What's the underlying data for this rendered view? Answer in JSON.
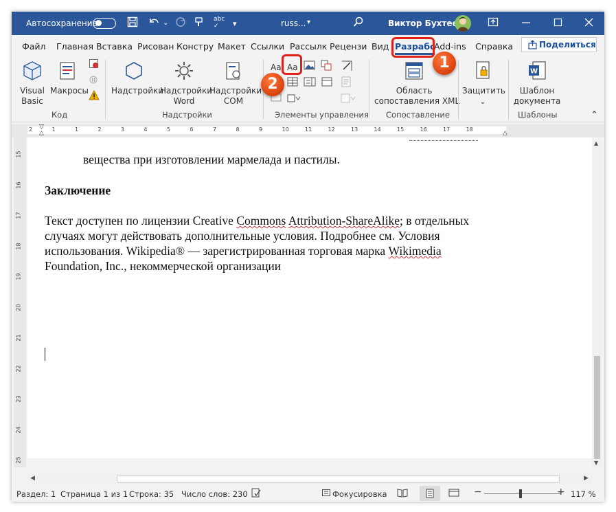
{
  "titlebar": {
    "autosave_label": "Автосохранение",
    "filename": "russ...",
    "user_name": "Виктор Бухтеев"
  },
  "tabs": [
    "Файл",
    "Главная",
    "Вставка",
    "Рисован",
    "Констру",
    "Макет",
    "Ссылки",
    "Рассылк",
    "Рецензи",
    "Вид",
    "Разрабс",
    "Add-ins",
    "Справка"
  ],
  "share_label": "Поделиться",
  "ribbon": {
    "code": {
      "visual_basic": [
        "Visual",
        "Basic"
      ],
      "macros": "Макросы",
      "label": "Код"
    },
    "addins": {
      "addins": "Надстройки",
      "word_addins": [
        "Надстройки",
        "Word"
      ],
      "com_addins": [
        "Надстройки",
        "COM"
      ],
      "label": "Надстройки"
    },
    "controls": {
      "rich_text_glyph": "Aa",
      "plain_text_glyph": "Aa",
      "label": "Элементы управления"
    },
    "mapping": {
      "xml_pane": [
        "Область",
        "сопоставления XML"
      ],
      "label": "Сопоставление"
    },
    "protect": {
      "protect": "Защитить"
    },
    "templates": {
      "doc_template": [
        "Шаблон",
        "документа"
      ],
      "label": "Шаблоны"
    }
  },
  "callouts": [
    "1",
    "2"
  ],
  "document": {
    "top_line": "вещества при изготовлении мармелада и пастилы.",
    "heading": "Заключение",
    "p1": "Текст доступен по лицензии Creative ",
    "p1_err1": "Commons",
    "p1_sp": " ",
    "p1_err2": "Attribution-ShareAlike",
    "p1_end": "; в отдельных",
    "p2": "случаях могут действовать дополнительные условия. Подробнее см. Условия",
    "p3": "использования. Wikipedia® — зарегистрированная торговая марка ",
    "p3_err": "Wikimedia",
    "p4": "Foundation, Inc., некоммерческой организации"
  },
  "ruler_h": [
    "2",
    "1",
    "1",
    "2",
    "3",
    "4",
    "5",
    "6",
    "7",
    "8",
    "9",
    "10",
    "11",
    "12",
    "13",
    "14",
    "15",
    "16",
    "17",
    "18"
  ],
  "ruler_v": [
    "15",
    "16",
    "17",
    "18",
    "19",
    "20",
    "21",
    "22",
    "23",
    "24",
    "25"
  ],
  "status": {
    "section": "Раздел: 1",
    "page": "Страница 1 из 1",
    "line": "Строка: 35",
    "words": "Число слов: 230",
    "focus": "Фокусировка",
    "zoom": "117 %"
  }
}
